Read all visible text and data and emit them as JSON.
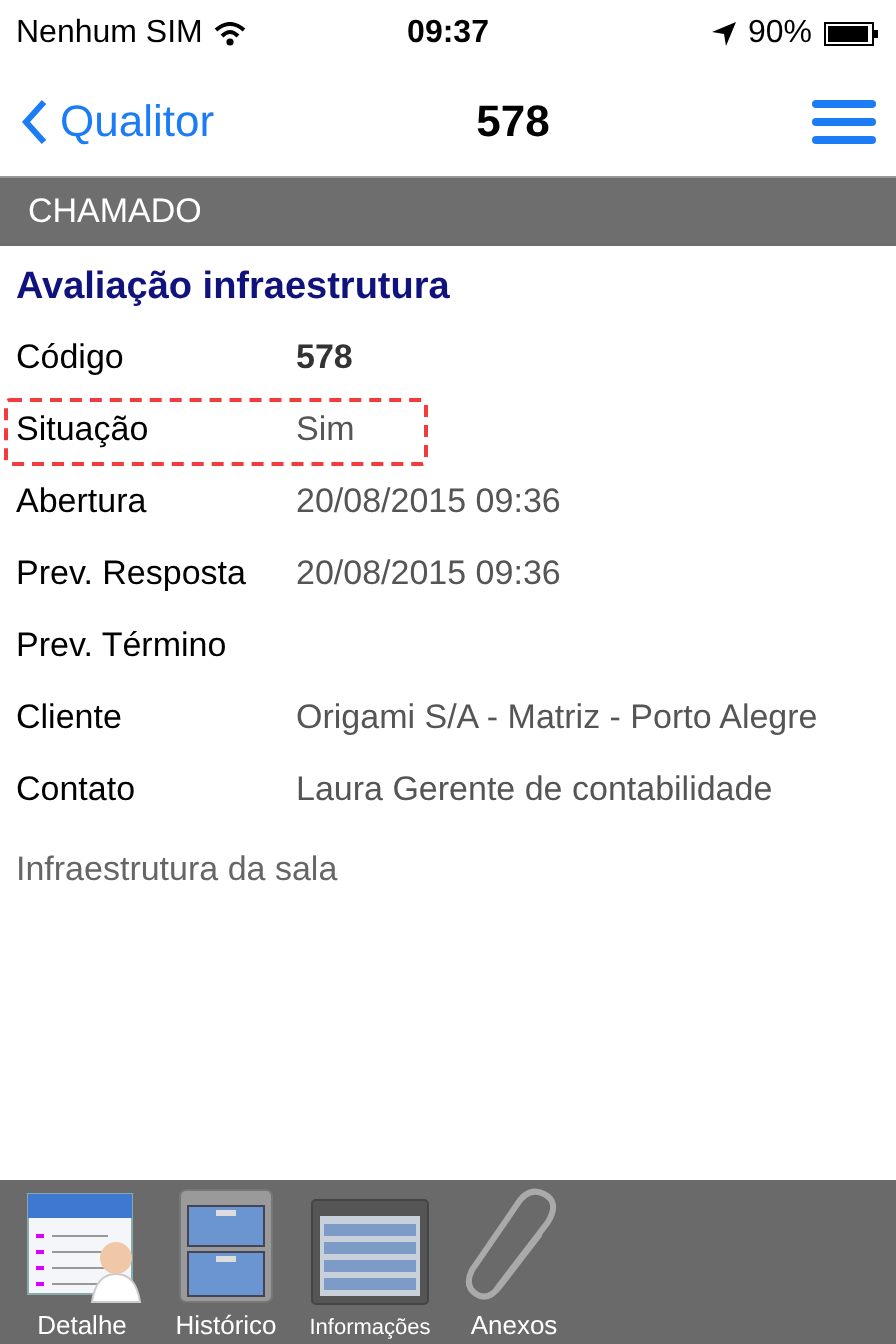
{
  "status_bar": {
    "carrier": "Nenhum SIM",
    "time": "09:37",
    "battery": "90%"
  },
  "nav_bar": {
    "back": "Qualitor",
    "title": "578"
  },
  "section": {
    "title": "CHAMADO"
  },
  "ticket": {
    "title": "Avaliação infraestrutura",
    "fields": [
      {
        "label": "Código",
        "value": "578",
        "bold": true,
        "highlighted": false
      },
      {
        "label": "Situação",
        "value": "Sim",
        "bold": false,
        "highlighted": true
      },
      {
        "label": "Abertura",
        "value": "20/08/2015 09:36",
        "bold": false,
        "highlighted": false
      },
      {
        "label": "Prev. Resposta",
        "value": "20/08/2015 09:36",
        "bold": false,
        "highlighted": false
      },
      {
        "label": "Prev. Término",
        "highlighted": false
      },
      {
        "label": "Cliente",
        "value": "Origami S/A - Matriz - Porto Alegre",
        "bold": false,
        "highlighted": false
      },
      {
        "label": "Contato",
        "value": "Laura Gerente de contabilidade",
        "bold": false,
        "highlighted": false
      }
    ],
    "description": "Infraestrutura da sala"
  },
  "tab_bar": [
    {
      "kind": "detail",
      "label": "Detalhe"
    },
    {
      "kind": "cabinet",
      "label": "Histórico"
    },
    {
      "kind": "window",
      "label": "Informações"
    },
    {
      "kind": "clip",
      "label": "Anexos"
    }
  ]
}
